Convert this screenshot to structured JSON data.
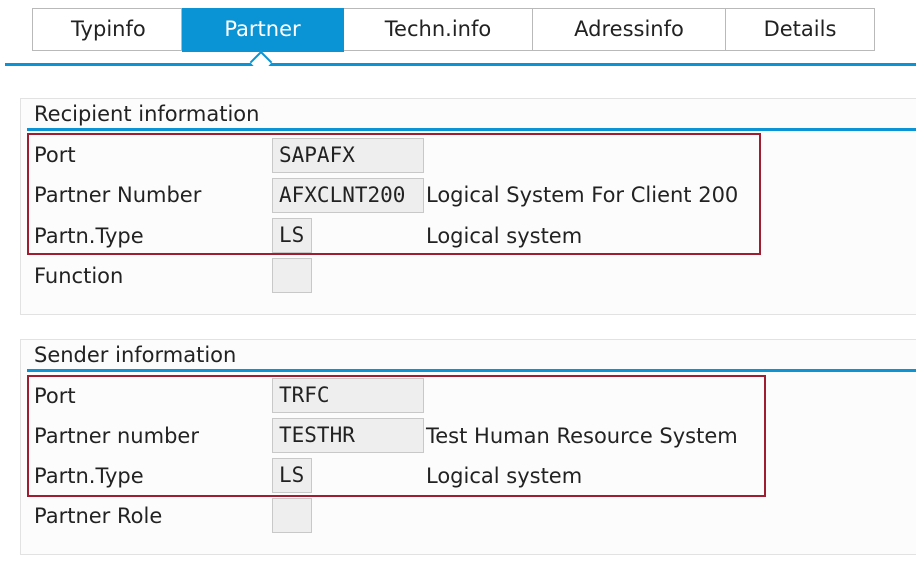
{
  "tabs": {
    "typinfo": "Typinfo",
    "partner": "Partner",
    "techn": "Techn.info",
    "adress": "Adressinfo",
    "details": "Details",
    "active": "Partner"
  },
  "recipient": {
    "title": "Recipient information",
    "port_label": "Port",
    "port_value": "SAPAFX",
    "partner_label": "Partner Number",
    "partner_value": "AFXCLNT200",
    "partner_desc": "Logical System For Client 200",
    "type_label": "Partn.Type",
    "type_value": "LS",
    "type_desc": "Logical system",
    "function_label": "Function",
    "function_value": ""
  },
  "sender": {
    "title": "Sender information",
    "port_label": "Port",
    "port_value": "TRFC",
    "partner_label": "Partner number",
    "partner_value": "TESTHR",
    "partner_desc": "Test Human Resource System",
    "type_label": "Partn.Type",
    "type_value": "LS",
    "type_desc": "Logical system",
    "role_label": "Partner Role",
    "role_value": ""
  },
  "colors": {
    "accent": "#0a94d6",
    "highlight_border": "#a01c30"
  }
}
